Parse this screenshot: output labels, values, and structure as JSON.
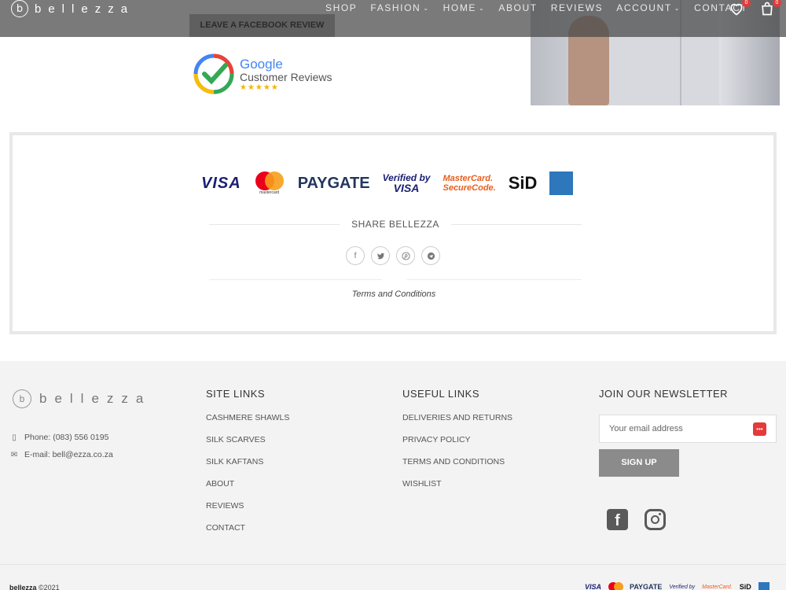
{
  "header": {
    "logo_letter": "b",
    "logo_text": "bellezza",
    "nav": [
      {
        "label": "SHOP",
        "has_dropdown": false
      },
      {
        "label": "FASHION",
        "has_dropdown": true
      },
      {
        "label": "HOME",
        "has_dropdown": true
      },
      {
        "label": "ABOUT",
        "has_dropdown": false
      },
      {
        "label": "REVIEWS",
        "has_dropdown": false
      },
      {
        "label": "ACCOUNT",
        "has_dropdown": true
      },
      {
        "label": "CONTACT",
        "has_dropdown": false
      }
    ],
    "wishlist_count": "0",
    "cart_count": "0"
  },
  "reviews": {
    "facebook_button": "LEAVE A FACEBOOK REVIEW",
    "google_title": "Google",
    "google_subtitle": "Customer Reviews",
    "google_stars": "★★★★★"
  },
  "payments": {
    "visa": "VISA",
    "mastercard": "mastercard",
    "paygate": "PAYGATE",
    "verified_by_visa_1": "Verified by",
    "verified_by_visa_2": "VISA",
    "mc_securecode_1": "MasterCard.",
    "mc_securecode_2": "SecureCode.",
    "sid": "SiD",
    "amex": "AMERICAN EXPRESS"
  },
  "share": {
    "title": "SHARE BELLEZZA",
    "icons": [
      "facebook-icon",
      "twitter-icon",
      "pinterest-icon",
      "telegram-icon"
    ],
    "terms_link": "Terms and Conditions"
  },
  "footer": {
    "logo_text": "bellezza",
    "phone": "Phone: (083) 556 0195",
    "email": "E-mail: bell@ezza.co.za",
    "site_links": {
      "title": "SITE LINKS",
      "items": [
        "CASHMERE SHAWLS",
        "SILK SCARVES",
        "SILK KAFTANS",
        "ABOUT",
        "REVIEWS",
        "CONTACT"
      ]
    },
    "useful_links": {
      "title": "USEFUL LINKS",
      "items": [
        "DELIVERIES AND RETURNS",
        "PRIVACY POLICY",
        "TERMS AND CONDITIONS",
        "WISHLIST"
      ]
    },
    "newsletter": {
      "title": "JOIN OUR NEWSLETTER",
      "placeholder": "Your email address",
      "button": "SIGN UP"
    },
    "social": [
      "facebook-icon",
      "instagram-icon"
    ],
    "copyright_brand": "bellezza",
    "copyright_text": "©2021"
  },
  "colors": {
    "header_bg": "#464646",
    "footer_bg": "#f3f3f3",
    "signup_bg": "#8b8b8b",
    "badge": "#e03b3b"
  }
}
